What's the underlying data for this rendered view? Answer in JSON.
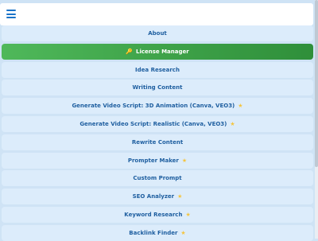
{
  "header": {
    "menu_icon": "hamburger-icon"
  },
  "menu": [
    {
      "label": "About",
      "star": false
    },
    {
      "label": "License Manager",
      "active": true,
      "icon": "key-icon"
    },
    {
      "label": "Idea Research",
      "star": false
    },
    {
      "label": "Writing Content",
      "star": false
    },
    {
      "label": "Generate Video Script: 3D Animation (Canva, VEO3)",
      "star": true
    },
    {
      "label": "Generate Video Script: Realistic (Canva, VEO3)",
      "star": true
    },
    {
      "label": "Rewrite Content",
      "star": false
    },
    {
      "label": "Prompter Maker",
      "star": true
    },
    {
      "label": "Custom Prompt",
      "star": false
    },
    {
      "label": "SEO Analyzer",
      "star": true
    },
    {
      "label": "Keyword Research",
      "star": true
    },
    {
      "label": "Backlink Finder",
      "star": true
    }
  ],
  "colors": {
    "accent": "#1f5fa0",
    "active_start": "#4fb85a",
    "active_end": "#2f8f3a",
    "item_bg": "#dcecfb",
    "page_bg": "#cfe3f5",
    "star": "#f4c542"
  }
}
